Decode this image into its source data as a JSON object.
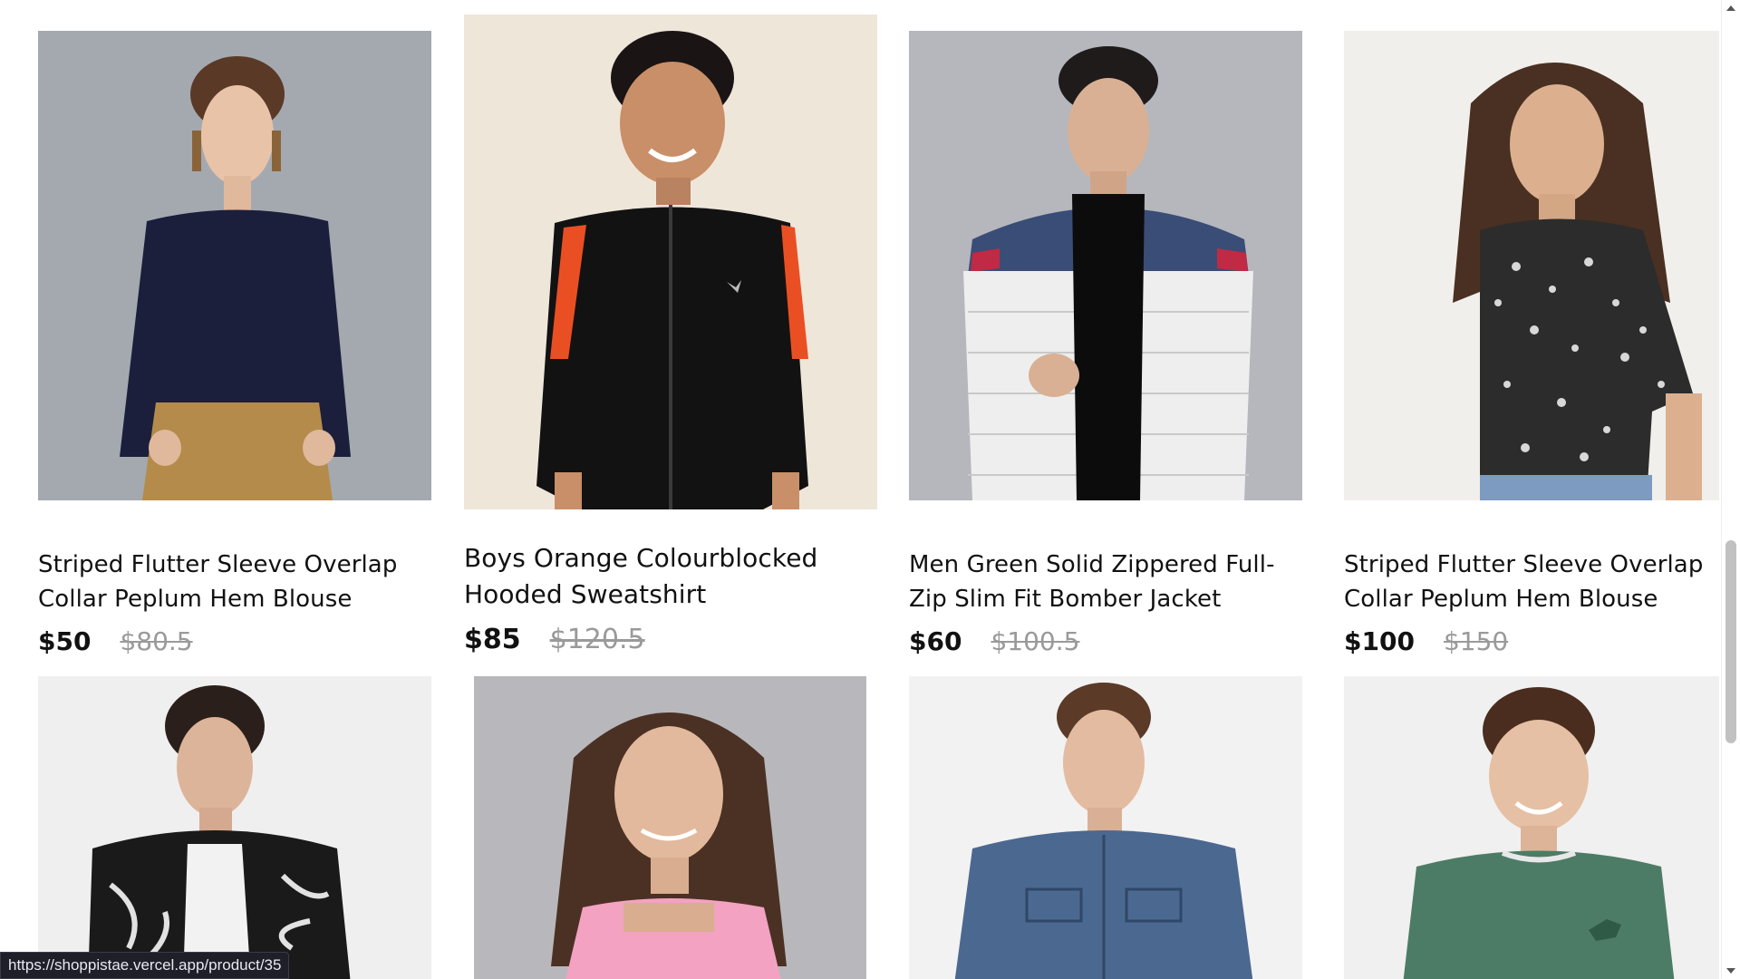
{
  "products": [
    {
      "title": "Striped Flutter Sleeve Overlap Collar Peplum Hem Blouse",
      "price": "$50",
      "old_price": "$80.5"
    },
    {
      "title": "Boys Orange Colourblocked Hooded Sweatshirt",
      "price": "$85",
      "old_price": "$120.5"
    },
    {
      "title": "Men Green Solid Zippered Full-Zip Slim Fit Bomber Jacket",
      "price": "$60",
      "old_price": "$100.5"
    },
    {
      "title": "Striped Flutter Sleeve Overlap Collar Peplum Hem Blouse",
      "price": "$100",
      "old_price": "$150"
    }
  ],
  "status_bar": {
    "url": "https://shoppistae.vercel.app/product/35"
  },
  "colors": {
    "text": "#111111",
    "old_price": "#9a9a9a",
    "status_bg": "#1f1f2a"
  }
}
